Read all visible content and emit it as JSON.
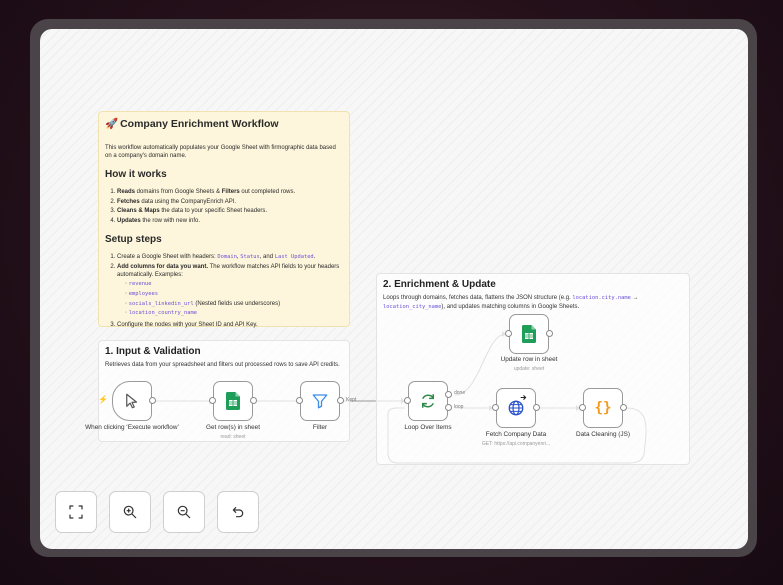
{
  "sticky_main": {
    "emoji": "🚀",
    "title": "Company Enrichment Workflow",
    "intro": "This workflow automatically populates your Google Sheet with firmographic data based on a company's domain name.",
    "how_title": "How it works",
    "how_steps": [
      {
        "b1": "Reads",
        "t1": " domains from Google Sheets & ",
        "b2": "Filters",
        "t2": " out completed rows."
      },
      {
        "b1": "Fetches",
        "t1": " data using the CompanyEnrich API.",
        "b2": "",
        "t2": ""
      },
      {
        "b1": "Cleans & Maps",
        "t1": " the data to your specific Sheet headers.",
        "b2": "",
        "t2": ""
      },
      {
        "b1": "Updates",
        "t1": " the row with new info.",
        "b2": "",
        "t2": ""
      }
    ],
    "setup_title": "Setup steps",
    "setup_1_text": "Create a Google Sheet with headers: ",
    "setup_1_codes": [
      "Domain",
      "Status",
      "Last Updated"
    ],
    "setup_1_sep1": ", ",
    "setup_1_sep2": ", and ",
    "setup_1_end": ".",
    "setup_2_bold": "Add columns for data you want.",
    "setup_2_text": " The workflow matches API fields to your headers automatically. Examples:",
    "setup_2_examples": [
      {
        "code": "revenue",
        "note": ""
      },
      {
        "code": "employees",
        "note": ""
      },
      {
        "code": "socials_linkedin_url",
        "note": " (Nested fields use underscores)"
      },
      {
        "code": "location_country_name",
        "note": ""
      }
    ],
    "setup_3": "Configure the nodes with your Sheet ID and API Key."
  },
  "sticky_input": {
    "title": "1. Input & Validation",
    "desc": "Retrieves data from your spreadsheet and filters out processed rows to save API credits."
  },
  "sticky_enrich": {
    "title": "2. Enrichment & Update",
    "desc_a": "Loops through domains, fetches data, flattens the JSON structure (e.g. ",
    "code_a": "location.city.name",
    "arrow": " → ",
    "code_b": "location_city_name",
    "desc_b": "), and updates matching columns in Google Sheets."
  },
  "nodes": {
    "trigger": {
      "label": "When clicking ‘Execute workflow’",
      "icon": "cursor-icon"
    },
    "get_rows": {
      "label": "Get row(s) in sheet",
      "sub": "read: sheet",
      "icon": "google-sheets-icon"
    },
    "filter": {
      "label": "Filter",
      "icon": "filter-icon"
    },
    "loop": {
      "label": "Loop Over Items",
      "icon": "refresh-icon"
    },
    "update_row": {
      "label": "Update row in sheet",
      "sub": "update: sheet",
      "icon": "google-sheets-icon"
    },
    "fetch": {
      "label": "Fetch Company Data",
      "sub": "GET: https://api.companyenri...",
      "icon": "globe-icon"
    },
    "cleaning": {
      "label": "Data Cleaning (JS)",
      "icon": "code-braces-icon"
    }
  },
  "edge_labels": {
    "kept": "Kept",
    "done": "done",
    "loop": "loop"
  },
  "controls": {
    "fit": "fit-view-icon",
    "zoom_in": "zoom-in-icon",
    "zoom_out": "zoom-out-icon",
    "reset": "undo-icon"
  },
  "colors": {
    "sheets_green": "#1e9e58",
    "filter_blue": "#3f8ee8",
    "loop_green": "#2f8a4a",
    "globe_blue": "#2a52c9",
    "code_orange": "#f29a1d",
    "sticky_yellow": "#fdf6dc",
    "trigger_bolt": "#e04b4b"
  }
}
